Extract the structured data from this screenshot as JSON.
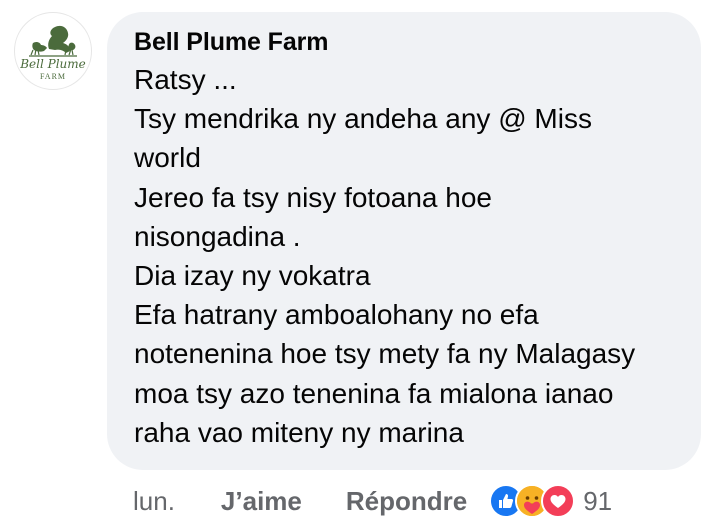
{
  "comment": {
    "author": "Bell Plume Farm",
    "avatar": {
      "logo_text": "Bell Plume",
      "logo_subtext": "FARM"
    },
    "lines": [
      "Ratsy ...",
      "Tsy mendrika ny andeha any @ Miss",
      "world",
      "Jereo fa tsy nisy fotoana hoe",
      "nisongadina .",
      "Dia izay ny vokatra",
      "Efa hatrany amboalohany no efa",
      "notenenina hoe tsy mety fa ny Malagasy",
      "moa tsy azo tenenina fa mialona ianao",
      "raha vao miteny ny marina"
    ]
  },
  "actions": {
    "time": "lun.",
    "like_label": "J’aime",
    "reply_label": "Répondre"
  },
  "reactions": {
    "icons": [
      "like-icon",
      "care-icon",
      "love-icon"
    ],
    "count": "91",
    "colors": {
      "like": "#1877f2",
      "care": "#f7b125",
      "love": "#f33e58"
    }
  }
}
